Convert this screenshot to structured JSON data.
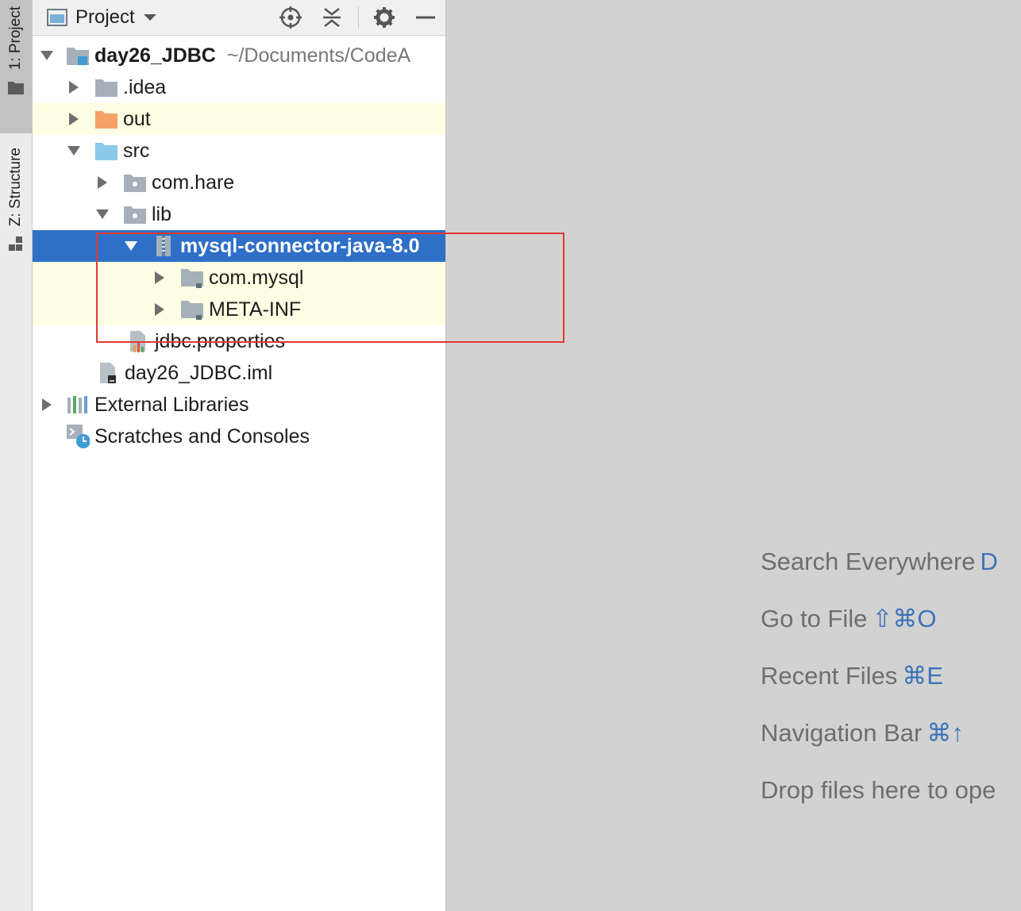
{
  "stripe": {
    "project_tab": "1: Project",
    "structure_tab": "Z: Structure"
  },
  "toolbar": {
    "title": "Project"
  },
  "tree": [
    {
      "label": "day26_JDBC",
      "path": "~/Documents/CodeA",
      "icon": "module-folder-icon"
    },
    {
      "label": ".idea",
      "icon": "folder-icon"
    },
    {
      "label": "out",
      "icon": "output-folder-icon"
    },
    {
      "label": "src",
      "icon": "source-folder-icon"
    },
    {
      "label": "com.hare",
      "icon": "package-icon"
    },
    {
      "label": "lib",
      "icon": "package-icon"
    },
    {
      "label": "mysql-connector-java-8.0",
      "icon": "jar-archive-icon"
    },
    {
      "label": "com.mysql",
      "icon": "library-folder-icon"
    },
    {
      "label": "META-INF",
      "icon": "library-folder-icon"
    },
    {
      "label": "jdbc.properties",
      "icon": "properties-file-icon"
    },
    {
      "label": "day26_JDBC.iml",
      "icon": "module-file-icon"
    },
    {
      "label": "External Libraries",
      "icon": "libraries-icon"
    },
    {
      "label": "Scratches and Consoles",
      "icon": "scratches-icon"
    }
  ],
  "editor_hints": [
    {
      "label": "Search Everywhere",
      "shortcut": "D"
    },
    {
      "label": "Go to File",
      "shortcut": "⇧⌘O"
    },
    {
      "label": "Recent Files",
      "shortcut": "⌘E"
    },
    {
      "label": "Navigation Bar",
      "shortcut": "⌘↑"
    },
    {
      "label": "Drop files here to ope",
      "shortcut": ""
    }
  ],
  "colors": {
    "selection": "#2e6fc7",
    "highlight_row": "#fefee4",
    "annotation": "#e03a33",
    "shortcut": "#3d73b8"
  }
}
